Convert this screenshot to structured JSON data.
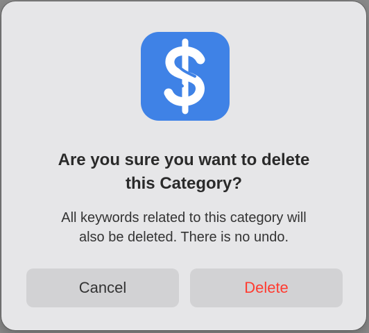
{
  "dialog": {
    "app_icon": "dollar-sign-icon",
    "title_line1": "Are you sure you want to delete",
    "title_line2": "this Category?",
    "message_line1": "All keywords related to this category will",
    "message_line2": "also be deleted. There is no undo.",
    "cancel_label": "Cancel",
    "delete_label": "Delete"
  },
  "colors": {
    "icon_background": "#3f82e6",
    "destructive": "#ff3b30",
    "button_background": "#d2d2d4",
    "dialog_background": "#e6e6e8"
  }
}
